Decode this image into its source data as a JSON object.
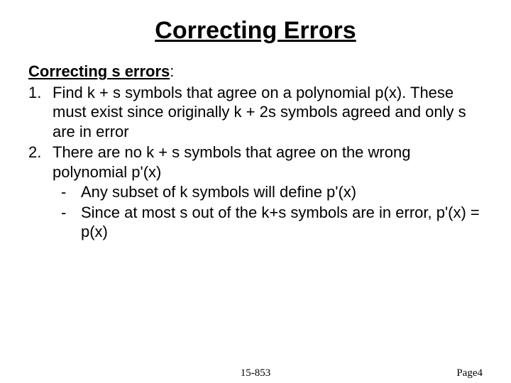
{
  "title": "Correcting Errors",
  "subheading": "Correcting s errors",
  "colon": ":",
  "items": [
    {
      "num": "1.",
      "text": "Find k + s symbols that agree on a polynomial p(x). These must exist since originally k + 2s symbols agreed and only s are in error"
    },
    {
      "num": "2.",
      "text": "There are no k + s symbols that agree on the wrong polynomial p'(x)",
      "subs": [
        "Any subset of k symbols will define p'(x)",
        "Since at most s out of the k+s symbols are in error, p'(x) = p(x)"
      ]
    }
  ],
  "footer": {
    "center": "15-853",
    "right": "Page4"
  }
}
